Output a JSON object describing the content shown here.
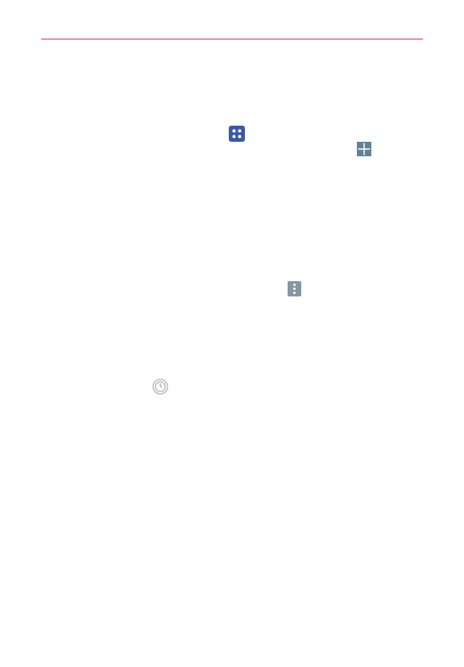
{
  "colors": {
    "header_rule": "#d9343f",
    "apps_icon_bg": "#3a57a8",
    "add_icon_bg": "#5f8396",
    "menu_icon_bg": "#8796a0",
    "clock_icon_stroke": "#9a9a9a",
    "icon_glyph": "#ffffff"
  },
  "icons": {
    "apps": "apps-grid-icon",
    "add": "add-plus-icon",
    "menu": "menu-more-icon",
    "clock": "clock-icon"
  }
}
